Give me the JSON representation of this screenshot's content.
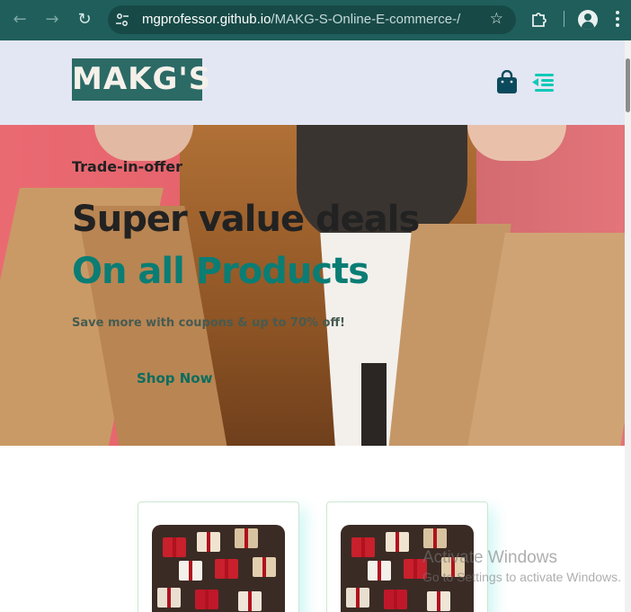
{
  "browser": {
    "url_host": "mgprofessor.github.io",
    "url_path": "/MAKG-S-Online-E-commerce-/",
    "icons": [
      "back-icon",
      "forward-icon",
      "reload-icon",
      "site-info-icon",
      "bookmark-star-icon",
      "extensions-icon",
      "profile-icon",
      "more-menu-icon"
    ]
  },
  "header": {
    "logo_text": "MAKG'S",
    "icons": [
      "shopping-bag-icon",
      "menu-toggle-icon"
    ]
  },
  "hero": {
    "eyebrow": "Trade-in-offer",
    "headline": "Super value deals",
    "subheadline": "On all Products",
    "description": "Save more with coupons & up to 70% off!",
    "cta_label": "Shop Now"
  },
  "watermark": {
    "line1": "Activate Windows",
    "line2": "Go to Settings to activate Windows."
  },
  "colors": {
    "chrome_bar": "#1f5e5b",
    "header_bg": "#e3e6f3",
    "accent_teal": "#0a7d74",
    "logo_bg": "#2c6a66"
  }
}
